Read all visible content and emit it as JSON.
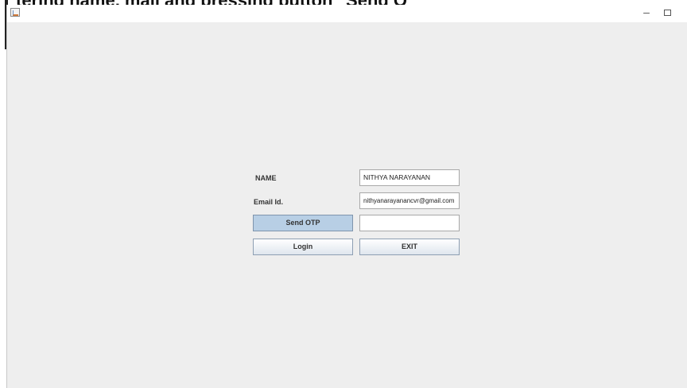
{
  "caption": "tering name, mail and pressing button \"Send O",
  "window": {
    "minimize_glyph": "–"
  },
  "form": {
    "name_label": "NAME",
    "name_value": "NITHYA NARAYANAN",
    "email_label": "Email Id.",
    "email_value": "nithyanarayanancvr@gmail.com",
    "send_otp_label": "Send OTP",
    "otp_value": "",
    "login_label": "Login",
    "exit_label": "EXIT"
  }
}
